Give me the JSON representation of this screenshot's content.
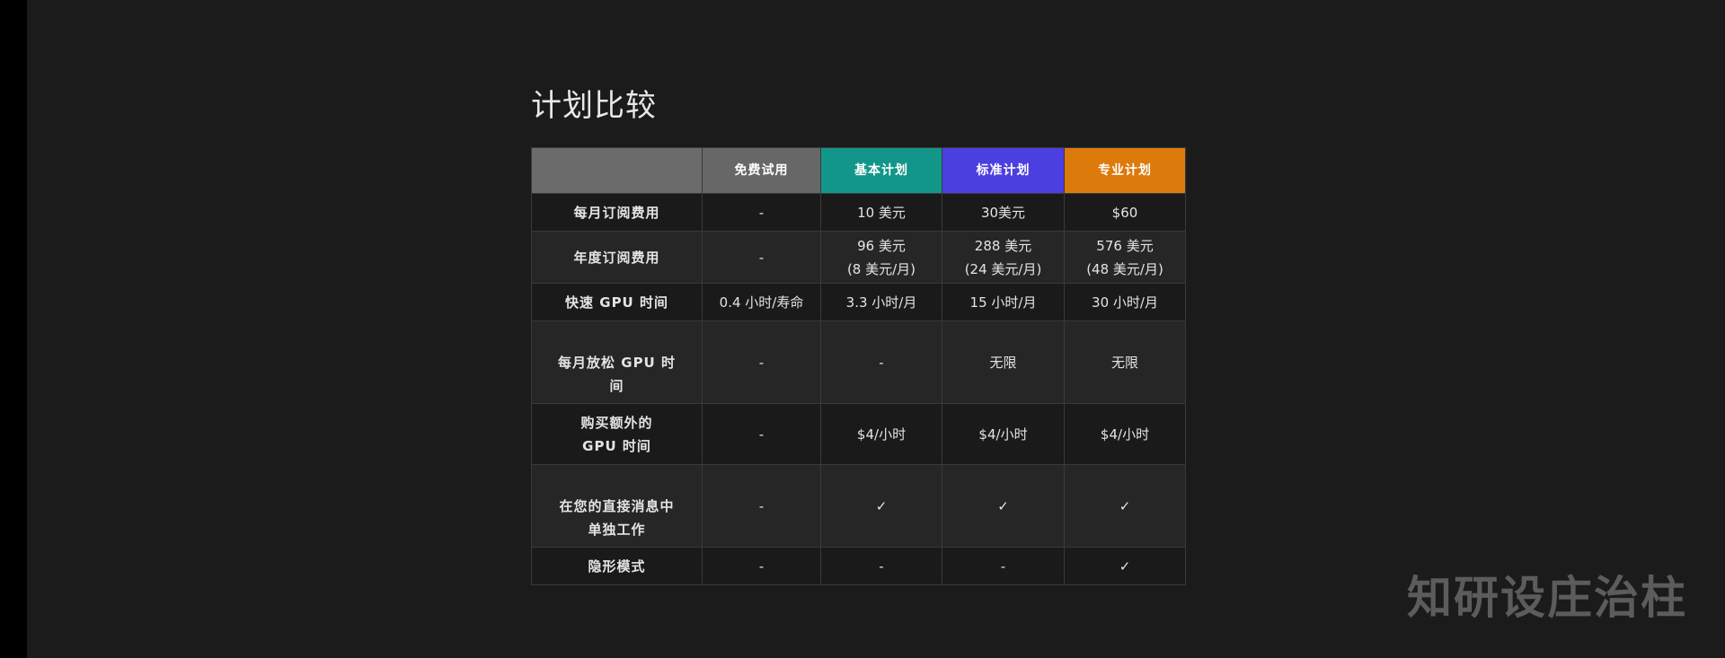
{
  "page_title": "计划比较",
  "colors": {
    "free": "#676767",
    "basic": "#13968a",
    "standard": "#4c3fe0",
    "pro": "#dc7a0c"
  },
  "plans": [
    {
      "label": "免费试用",
      "color": "#676767"
    },
    {
      "label": "基本计划",
      "color": "#13968a"
    },
    {
      "label": "标准计划",
      "color": "#4c3fe0"
    },
    {
      "label": "专业计划",
      "color": "#dc7a0c"
    }
  ],
  "rows": [
    {
      "label": [
        "每月订阅费用"
      ],
      "cells": [
        [
          "-"
        ],
        [
          "10 美元"
        ],
        [
          "30美元"
        ],
        [
          "$60"
        ]
      ]
    },
    {
      "label": [
        "年度订阅费用"
      ],
      "cells": [
        [
          "-"
        ],
        [
          "96 美元",
          "(8 美元/月)"
        ],
        [
          "288 美元",
          "(24 美元/月)"
        ],
        [
          "576 美元",
          "(48 美元/月)"
        ]
      ]
    },
    {
      "label": [
        "快速 GPU 时间"
      ],
      "cells": [
        [
          "0.4 小时/寿命"
        ],
        [
          "3.3 小时/月"
        ],
        [
          "15 小时/月"
        ],
        [
          "30 小时/月"
        ]
      ]
    },
    {
      "label": [
        "每月放松 GPU 时",
        "间"
      ],
      "cells": [
        [
          "-"
        ],
        [
          "-"
        ],
        [
          "无限"
        ],
        [
          "无限"
        ]
      ]
    },
    {
      "label": [
        "购买额外的",
        "GPU 时间"
      ],
      "cells": [
        [
          "-"
        ],
        [
          "$4/小时"
        ],
        [
          "$4/小时"
        ],
        [
          "$4/小时"
        ]
      ]
    },
    {
      "label": [
        "在您的直接消息中",
        "单独工作"
      ],
      "cells": [
        [
          "-"
        ],
        [
          "✓"
        ],
        [
          "✓"
        ],
        [
          "✓"
        ]
      ]
    },
    {
      "label": [
        "隐形模式"
      ],
      "cells": [
        [
          "-"
        ],
        [
          "-"
        ],
        [
          "-"
        ],
        [
          "✓"
        ]
      ]
    }
  ],
  "watermark": "知研设庄治柱"
}
